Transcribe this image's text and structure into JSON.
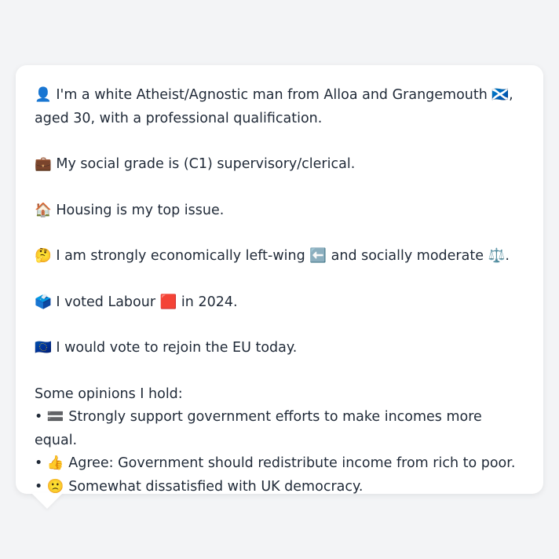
{
  "profile": {
    "identity": "👤 I'm a white Atheist/Agnostic man from Alloa and Grangemouth 🏴󠁧󠁢󠁳󠁣󠁴󠁿, aged 30, with a professional qualification.",
    "social_grade": "💼 My social grade is (C1) supervisory/clerical.",
    "top_issue": "🏠 Housing is my top issue.",
    "ideology": "🤔 I am strongly economically left-wing ⬅️ and socially moderate ⚖️.",
    "vote_2024": "🗳️ I voted Labour 🟥 in 2024.",
    "eu": "🇪🇺 I would vote to rejoin the EU today."
  },
  "opinions": {
    "heading": "Some opinions I hold:",
    "items": [
      "• 🟰 Strongly support government efforts to make incomes more equal.",
      "• 👍 Agree: Government should redistribute income from rich to poor.",
      "• 🙁 Somewhat dissatisfied with UK democracy."
    ]
  }
}
